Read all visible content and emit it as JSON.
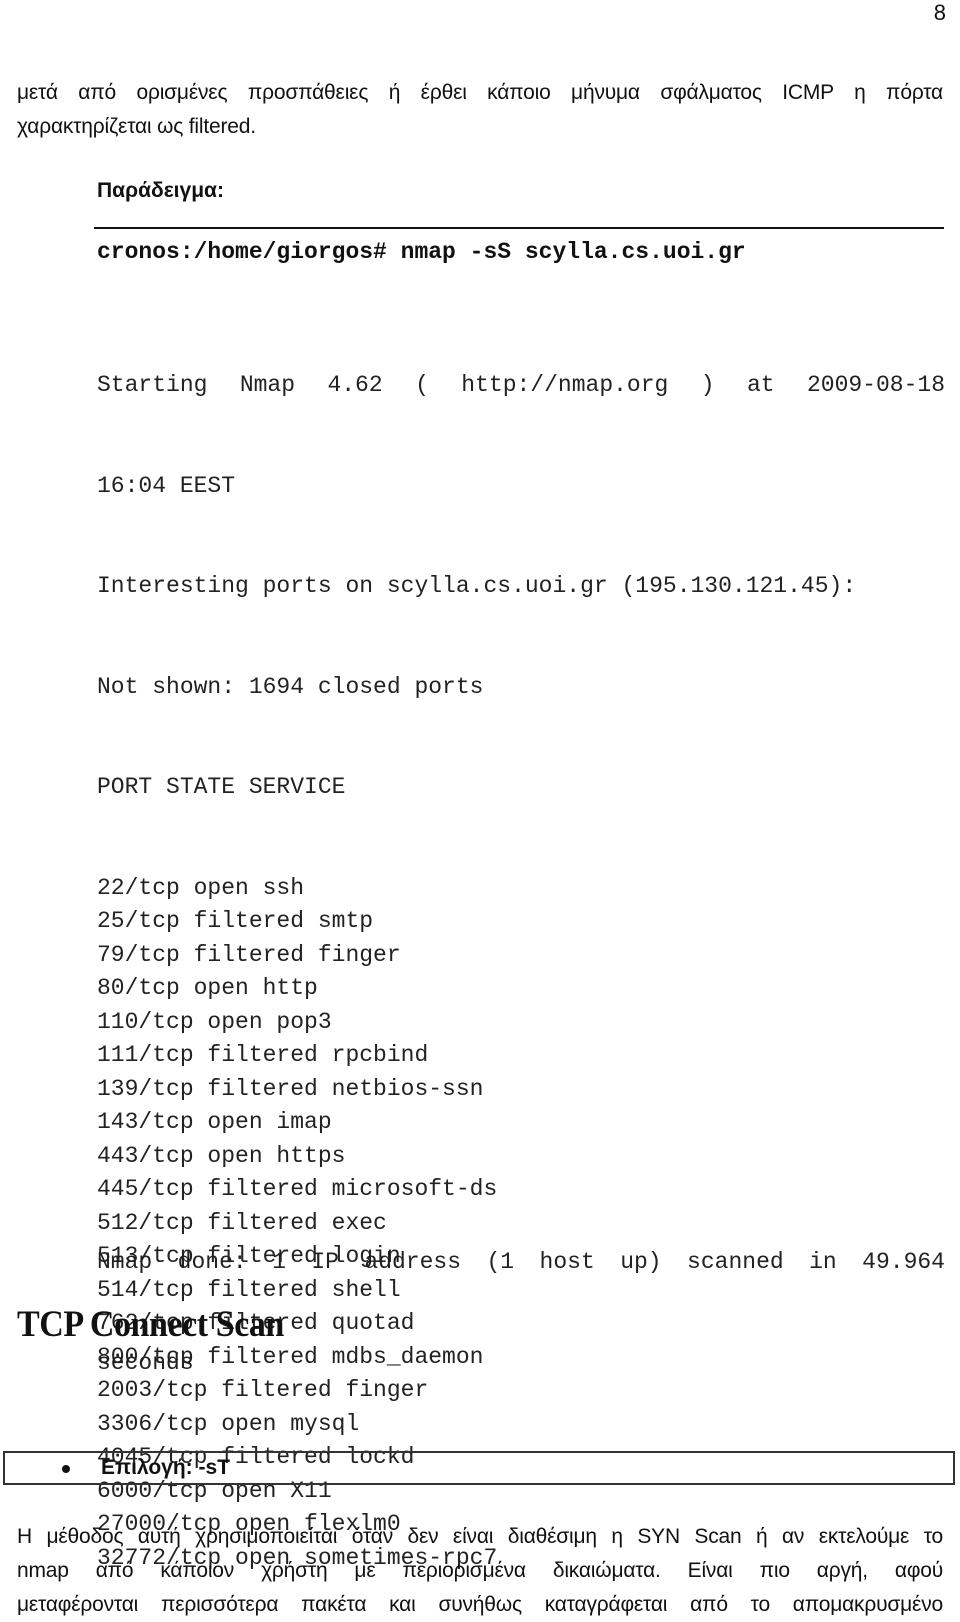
{
  "page_number": "8",
  "intro_paragraph": {
    "lines": [
      "μετά από ορισμένες προσπάθειες ή έρθει κάποιο μήνυμα σφάλματος ICMP η πόρτα",
      "χαρακτηρίζεται ως filtered."
    ]
  },
  "example": {
    "label": "Παράδειγμα:",
    "command": "cronos:/home/giorgos# nmap -sS scylla.cs.uoi.gr",
    "output_header": [
      "Starting Nmap 4.62 ( http://nmap.org ) at 2009-08-18",
      "16:04 EEST",
      "Interesting ports on scylla.cs.uoi.gr (195.130.121.45):",
      "Not shown: 1694 closed ports",
      "PORT STATE SERVICE"
    ],
    "ports": [
      {
        "port": "22/tcp",
        "state": "open",
        "service": "ssh"
      },
      {
        "port": "25/tcp",
        "state": "filtered",
        "service": "smtp"
      },
      {
        "port": "79/tcp",
        "state": "filtered",
        "service": "finger"
      },
      {
        "port": "80/tcp",
        "state": "open",
        "service": "http"
      },
      {
        "port": "110/tcp",
        "state": "open",
        "service": "pop3"
      },
      {
        "port": "111/tcp",
        "state": "filtered",
        "service": "rpcbind"
      },
      {
        "port": "139/tcp",
        "state": "filtered",
        "service": "netbios-ssn"
      },
      {
        "port": "143/tcp",
        "state": "open",
        "service": "imap"
      },
      {
        "port": "443/tcp",
        "state": "open",
        "service": "https"
      },
      {
        "port": "445/tcp",
        "state": "filtered",
        "service": "microsoft-ds"
      },
      {
        "port": "512/tcp",
        "state": "filtered",
        "service": "exec"
      },
      {
        "port": "513/tcp",
        "state": "filtered",
        "service": "login"
      },
      {
        "port": "514/tcp",
        "state": "filtered",
        "service": "shell"
      },
      {
        "port": "762/tcp",
        "state": "filtered",
        "service": "quotad"
      },
      {
        "port": "800/tcp",
        "state": "filtered",
        "service": "mdbs_daemon"
      },
      {
        "port": "2003/tcp",
        "state": "filtered",
        "service": "finger"
      },
      {
        "port": "3306/tcp",
        "state": "open",
        "service": "mysql"
      },
      {
        "port": "4045/tcp",
        "state": "filtered",
        "service": "lockd"
      },
      {
        "port": "6000/tcp",
        "state": "open",
        "service": "X11"
      },
      {
        "port": "27000/tcp",
        "state": "open",
        "service": "flexlm0"
      },
      {
        "port": "32772/tcp",
        "state": "open",
        "service": "sometimes-rpc7"
      }
    ],
    "done_lines": [
      "Nmap done: 1 IP address (1 host up) scanned in 49.964",
      "seconds"
    ]
  },
  "section": {
    "heading": "TCP Connect Scan",
    "option_label": "Επιλογή: -sT",
    "paragraph_lines": [
      "Η μέθοδος αυτή χρησιμοποιείται όταν δεν είναι διαθέσιμη η SYN Scan ή αν εκτελούμε το",
      "nmap από κάποιον χρήστη με περιορισμένα δικαιώματα. Είναι πιο αργή, αφού",
      "μεταφέρονται περισσότερα πακέτα και συνήθως καταγράφεται από το απομακρυσμένο"
    ]
  }
}
